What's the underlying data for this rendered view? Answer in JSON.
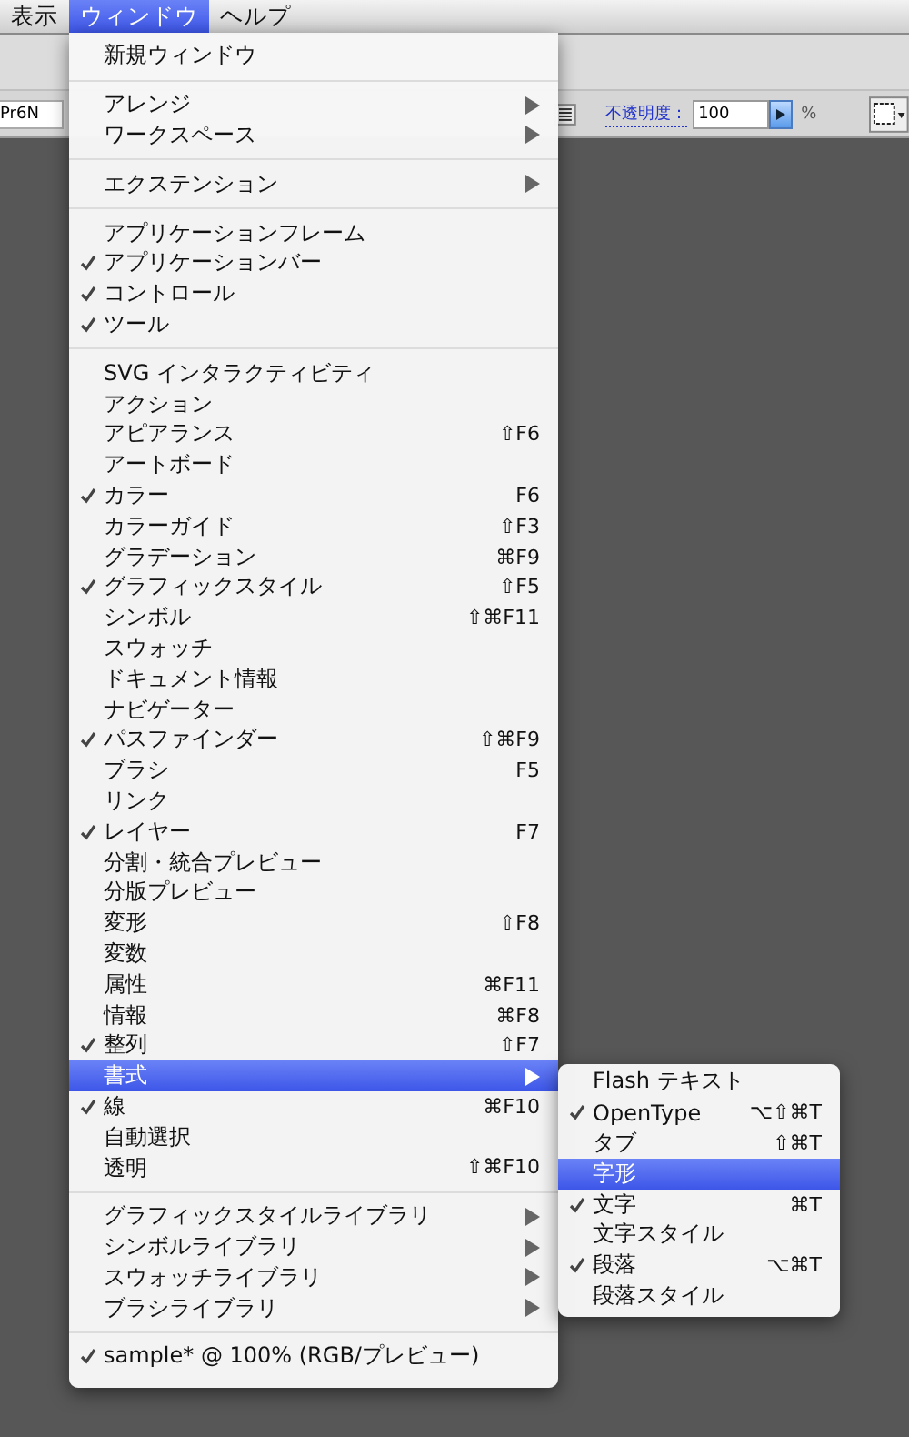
{
  "menubar": [
    {
      "label": "表示",
      "selected": false
    },
    {
      "label": "ウィンドウ",
      "selected": true
    },
    {
      "label": "ヘルプ",
      "selected": false
    }
  ],
  "toolbar": {
    "font_field": {
      "value": "Pr6N"
    },
    "opacity_label": "不透明度：",
    "opacity_field": {
      "value": "100"
    },
    "percent": "%"
  },
  "menu": {
    "sections": [
      [
        {
          "label": "新規ウィンドウ",
          "checked": false,
          "submenu": false,
          "selected": false
        }
      ],
      [
        {
          "label": "アレンジ",
          "checked": false,
          "submenu": true,
          "selected": false
        },
        {
          "label": "ワークスペース",
          "checked": false,
          "submenu": true,
          "selected": false
        }
      ],
      [
        {
          "label": "エクステンション",
          "checked": false,
          "submenu": true,
          "selected": false
        }
      ],
      [
        {
          "label": "アプリケーションフレーム",
          "checked": false,
          "submenu": false,
          "selected": false
        },
        {
          "label": "アプリケーションバー",
          "checked": true,
          "submenu": false,
          "selected": false
        },
        {
          "label": "コントロール",
          "checked": true,
          "submenu": false,
          "selected": false
        },
        {
          "label": "ツール",
          "checked": true,
          "submenu": false,
          "selected": false
        }
      ],
      [
        {
          "label": "SVG インタラクティビティ",
          "checked": false,
          "submenu": false,
          "selected": false
        },
        {
          "label": "アクション",
          "checked": false,
          "submenu": false,
          "selected": false
        },
        {
          "label": "アピアランス",
          "checked": false,
          "shortcut": "⇧F6",
          "submenu": false,
          "selected": false
        },
        {
          "label": "アートボード",
          "checked": false,
          "submenu": false,
          "selected": false
        },
        {
          "label": "カラー",
          "checked": true,
          "shortcut": "F6",
          "submenu": false,
          "selected": false
        },
        {
          "label": "カラーガイド",
          "checked": false,
          "shortcut": "⇧F3",
          "submenu": false,
          "selected": false
        },
        {
          "label": "グラデーション",
          "checked": false,
          "shortcut": "⌘F9",
          "submenu": false,
          "selected": false
        },
        {
          "label": "グラフィックスタイル",
          "checked": true,
          "shortcut": "⇧F5",
          "submenu": false,
          "selected": false
        },
        {
          "label": "シンボル",
          "checked": false,
          "shortcut": "⇧⌘F11",
          "submenu": false,
          "selected": false
        },
        {
          "label": "スウォッチ",
          "checked": false,
          "submenu": false,
          "selected": false
        },
        {
          "label": "ドキュメント情報",
          "checked": false,
          "submenu": false,
          "selected": false
        },
        {
          "label": "ナビゲーター",
          "checked": false,
          "submenu": false,
          "selected": false
        },
        {
          "label": "パスファインダー",
          "checked": true,
          "shortcut": "⇧⌘F9",
          "submenu": false,
          "selected": false
        },
        {
          "label": "ブラシ",
          "checked": false,
          "shortcut": "F5",
          "submenu": false,
          "selected": false
        },
        {
          "label": "リンク",
          "checked": false,
          "submenu": false,
          "selected": false
        },
        {
          "label": "レイヤー",
          "checked": true,
          "shortcut": "F7",
          "submenu": false,
          "selected": false
        },
        {
          "label": "分割・統合プレビュー",
          "checked": false,
          "submenu": false,
          "selected": false
        },
        {
          "label": "分版プレビュー",
          "checked": false,
          "submenu": false,
          "selected": false
        },
        {
          "label": "変形",
          "checked": false,
          "shortcut": "⇧F8",
          "submenu": false,
          "selected": false
        },
        {
          "label": "変数",
          "checked": false,
          "submenu": false,
          "selected": false
        },
        {
          "label": "属性",
          "checked": false,
          "shortcut": "⌘F11",
          "submenu": false,
          "selected": false
        },
        {
          "label": "情報",
          "checked": false,
          "shortcut": "⌘F8",
          "submenu": false,
          "selected": false
        },
        {
          "label": "整列",
          "checked": true,
          "shortcut": "⇧F7",
          "submenu": false,
          "selected": false
        },
        {
          "label": "書式",
          "checked": false,
          "submenu": true,
          "selected": true
        },
        {
          "label": "線",
          "checked": true,
          "shortcut": "⌘F10",
          "submenu": false,
          "selected": false
        },
        {
          "label": "自動選択",
          "checked": false,
          "submenu": false,
          "selected": false
        },
        {
          "label": "透明",
          "checked": false,
          "shortcut": "⇧⌘F10",
          "submenu": false,
          "selected": false
        }
      ],
      [
        {
          "label": "グラフィックスタイルライブラリ",
          "checked": false,
          "submenu": true,
          "selected": false
        },
        {
          "label": "シンボルライブラリ",
          "checked": false,
          "submenu": true,
          "selected": false
        },
        {
          "label": "スウォッチライブラリ",
          "checked": false,
          "submenu": true,
          "selected": false
        },
        {
          "label": "ブラシライブラリ",
          "checked": false,
          "submenu": true,
          "selected": false
        }
      ],
      [
        {
          "label": "sample* @ 100% (RGB/プレビュー)",
          "checked": true,
          "submenu": false,
          "selected": false
        }
      ]
    ]
  },
  "submenu": {
    "items": [
      {
        "label": "Flash テキスト",
        "checked": false,
        "selected": false
      },
      {
        "label": "OpenType",
        "checked": true,
        "shortcut": "⌥⇧⌘T",
        "selected": false
      },
      {
        "label": "タブ",
        "checked": false,
        "shortcut": "⇧⌘T",
        "selected": false
      },
      {
        "label": "字形",
        "checked": false,
        "selected": true
      },
      {
        "label": "文字",
        "checked": true,
        "shortcut": "⌘T",
        "selected": false
      },
      {
        "label": "文字スタイル",
        "checked": false,
        "selected": false
      },
      {
        "label": "段落",
        "checked": true,
        "shortcut": "⌥⌘T",
        "selected": false
      },
      {
        "label": "段落スタイル",
        "checked": false,
        "selected": false
      }
    ]
  }
}
